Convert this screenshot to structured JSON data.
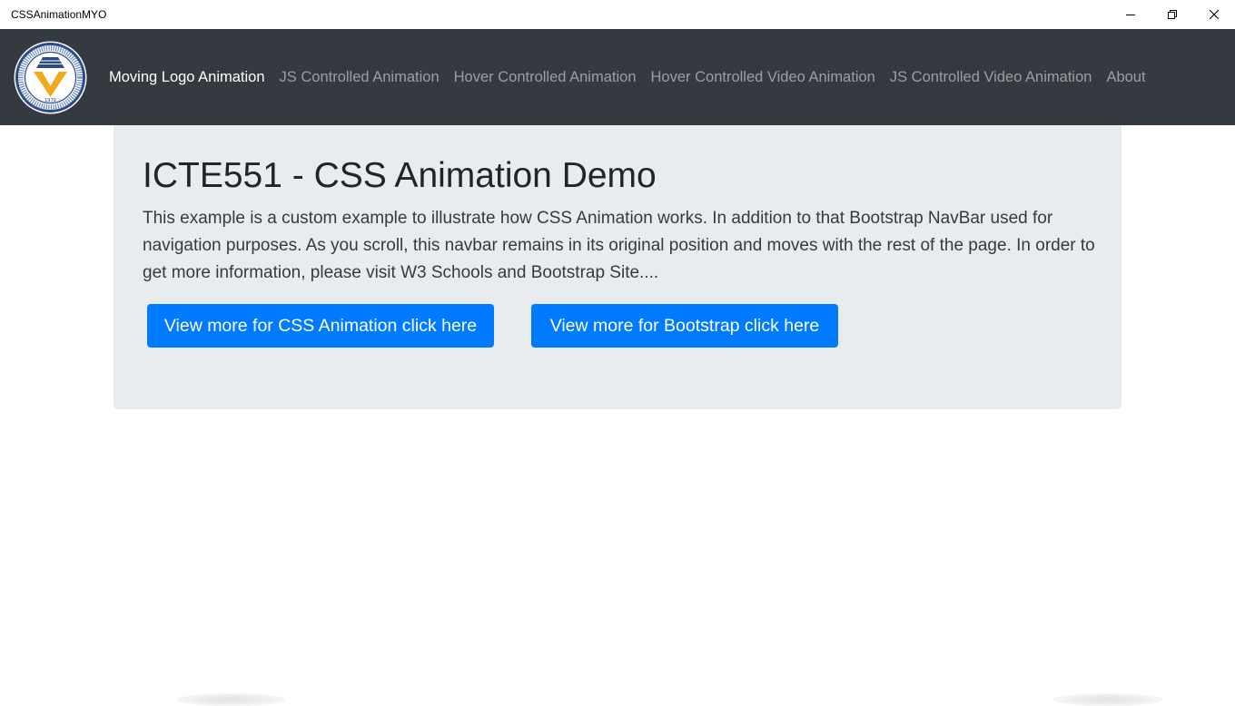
{
  "window": {
    "title": "CSSAnimationMYO",
    "controls": {
      "minimize_icon": "minimize-icon",
      "restore_icon": "restore-icon",
      "close_icon": "close-icon"
    }
  },
  "navbar": {
    "background": "#343a40",
    "logo": {
      "icon": "university-seal-logo",
      "year": "1979"
    },
    "items": [
      {
        "label": "Moving Logo Animation",
        "active": true
      },
      {
        "label": "JS Controlled Animation",
        "active": false
      },
      {
        "label": "Hover Controlled Animation",
        "active": false
      },
      {
        "label": "Hover Controlled Video Animation",
        "active": false
      },
      {
        "label": "JS Controlled Video Animation",
        "active": false
      },
      {
        "label": "About",
        "active": false
      }
    ]
  },
  "jumbotron": {
    "background": "#e9ecef",
    "title": "ICTE551 - CSS Animation Demo",
    "lead": "This example is a custom example to illustrate how CSS Animation works. In addition to that Bootstrap NavBar used for navigation purposes. As you scroll, this navbar remains in its original position and moves with the rest of the page. In order to get more information, please visit W3 Schools and Bootstrap Site....",
    "buttons": {
      "css_animation": "View more for CSS Animation click here",
      "bootstrap": "View more for Bootstrap click here"
    },
    "button_color": "#007bff"
  }
}
